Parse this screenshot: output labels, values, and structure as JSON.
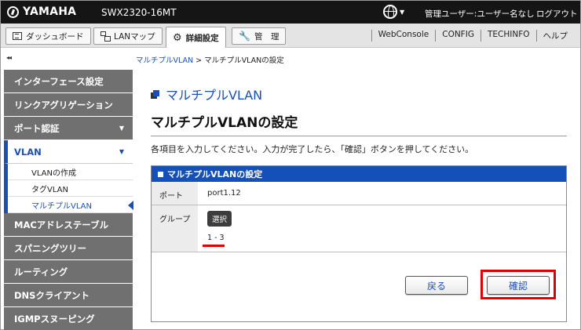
{
  "header": {
    "brand": "YAMAHA",
    "model": "SWX2320-16MT",
    "user": "管理ユーザー:ユーザー名なし",
    "logout": "ログアウト"
  },
  "tabs": [
    {
      "label": "ダッシュボード",
      "icon": "dashboard-icon"
    },
    {
      "label": "LANマップ",
      "icon": "lan-map-icon"
    },
    {
      "label": "詳細設定",
      "icon": "gear-icon",
      "active": true
    },
    {
      "label": "管　理",
      "icon": "wrench-icon"
    }
  ],
  "top_links": [
    "WebConsole",
    "CONFIG",
    "TECHINFO",
    "ヘルプ"
  ],
  "breadcrumb": {
    "parent": "マルチプルVLAN",
    "separator": " > ",
    "current": "マルチプルVLANの設定"
  },
  "sidebar": {
    "collapse_icon": "◂◂",
    "items": [
      {
        "label": "インターフェース設定"
      },
      {
        "label": "リンクアグリゲーション"
      },
      {
        "label": "ポート認証",
        "arrow": "▼"
      },
      {
        "label": "VLAN",
        "arrow": "▼",
        "open": true,
        "children": [
          "VLANの作成",
          "タグVLAN",
          "マルチプルVLAN"
        ]
      },
      {
        "label": "MACアドレステーブル"
      },
      {
        "label": "スパニングツリー"
      },
      {
        "label": "ルーティング"
      },
      {
        "label": "DNSクライアント"
      },
      {
        "label": "IGMPスヌーピング"
      }
    ]
  },
  "main": {
    "section_heading": "マルチプルVLAN",
    "page_title": "マルチプルVLANの設定",
    "instructions": "各項目を入力してください。入力が完了したら、「確認」ボタンを押してください。",
    "panel_title": "マルチプルVLANの設定",
    "port_label": "ポート",
    "port_value": "port1.12",
    "group_label": "グループ",
    "select_button": "選択",
    "group_value": "1 - 3",
    "back_button": "戻る",
    "confirm_button": "確認"
  },
  "colors": {
    "accent": "#1550b8",
    "highlight": "#e00000",
    "sidebar_item": "#707070",
    "topbar": "#151515"
  }
}
